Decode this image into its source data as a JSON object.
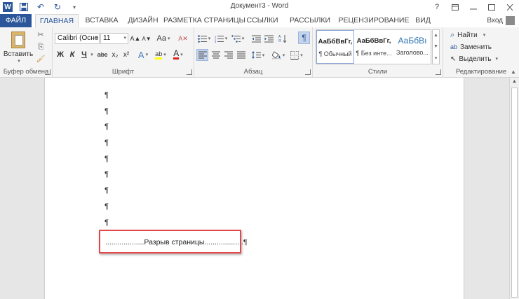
{
  "window": {
    "title": "Документ3 - Word",
    "controls": {
      "help": "?",
      "restore": "⧉",
      "minimize": "—",
      "maximize": "☐",
      "close": "✕"
    }
  },
  "quick_access": {
    "logo": "W",
    "save": "💾",
    "undo": "↶",
    "redo": "↻",
    "customize": "▾"
  },
  "tabs": [
    "ФАЙЛ",
    "ГЛАВНАЯ",
    "ВСТАВКА",
    "ДИЗАЙН",
    "РАЗМЕТКА СТРАНИЦЫ",
    "ССЫЛКИ",
    "РАССЫЛКИ",
    "РЕЦЕНЗИРОВАНИЕ",
    "ВИД"
  ],
  "active_tab": "ГЛАВНАЯ",
  "signin": "Вход",
  "clipboard": {
    "label": "Буфер обмена",
    "paste": "Вставить",
    "cut_icon": "✂",
    "copy_icon": "⎘",
    "painter_icon": "🖌"
  },
  "font": {
    "label": "Шрифт",
    "family": "Calibri (Осно",
    "size": "11",
    "grow": "A▲",
    "shrink": "A▼",
    "case": "Aa",
    "clear": "A✕",
    "bold": "Ж",
    "italic": "К",
    "underline": "Ч",
    "strike": "abc",
    "subscript": "x₂",
    "superscript": "x²",
    "effects": "A",
    "highlight": "ab",
    "color": "A"
  },
  "paragraph": {
    "label": "Абзац",
    "pilcrow": "¶"
  },
  "styles": {
    "label": "Стили",
    "items": [
      {
        "preview": "АаБбВвГг,",
        "name": "¶ Обычный"
      },
      {
        "preview": "АаБбВвГг,",
        "name": "¶ Без инте..."
      },
      {
        "preview": "АаБбВı",
        "name": "Заголово..."
      }
    ]
  },
  "editing": {
    "label": "Редактирование",
    "find": "Найти",
    "replace": "Заменить",
    "select": "Выделить"
  },
  "document": {
    "pilcrow": "¶",
    "paragraph_marks": 9,
    "page_break": "...................Разрыв страницы...................¶"
  },
  "colors": {
    "accent": "#2b579a",
    "highlight_box": "#e24848",
    "heading_style": "#2e74b5"
  }
}
